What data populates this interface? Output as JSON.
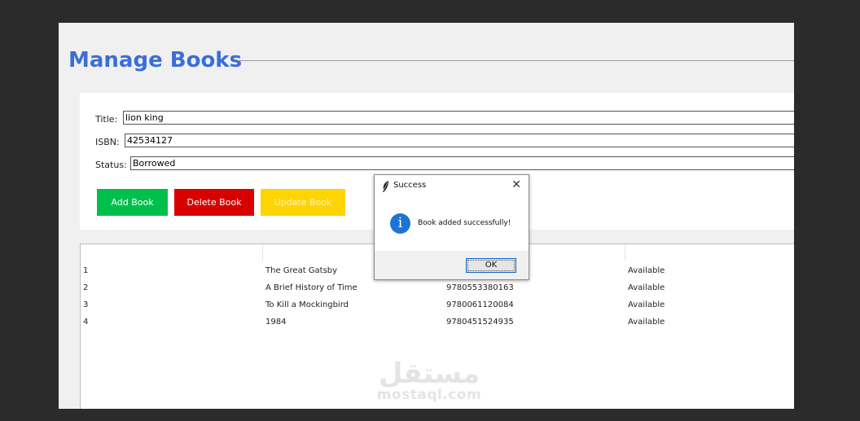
{
  "header": {
    "title": "Manage Books"
  },
  "form": {
    "title_label": "Title:",
    "title_value": "lion king",
    "isbn_label": "ISBN:",
    "isbn_value": "42534127",
    "status_label": "Status:",
    "status_value": "Borrowed"
  },
  "buttons": {
    "add": "Add Book",
    "delete": "Delete Book",
    "update": "Update Book"
  },
  "table": {
    "rows": [
      {
        "id": "1",
        "title": "The Great Gatsby",
        "isbn": "",
        "status": "Available"
      },
      {
        "id": "2",
        "title": "A Brief History of Time",
        "isbn": "9780553380163",
        "status": "Available"
      },
      {
        "id": "3",
        "title": "To Kill a Mockingbird",
        "isbn": "9780061120084",
        "status": "Available"
      },
      {
        "id": "4",
        "title": "1984",
        "isbn": "9780451524935",
        "status": "Available"
      }
    ]
  },
  "dialog": {
    "title": "Success",
    "message": "Book added successfully!",
    "ok_label": "OK",
    "icon": "info-icon"
  },
  "watermark": {
    "arabic": "مستقل",
    "latin": "mostaql.com"
  },
  "colors": {
    "accent": "#3b6fd6",
    "add_button": "#00c04b",
    "delete_button": "#d90000",
    "update_button": "#ffd400",
    "info_icon": "#1d74d2"
  }
}
